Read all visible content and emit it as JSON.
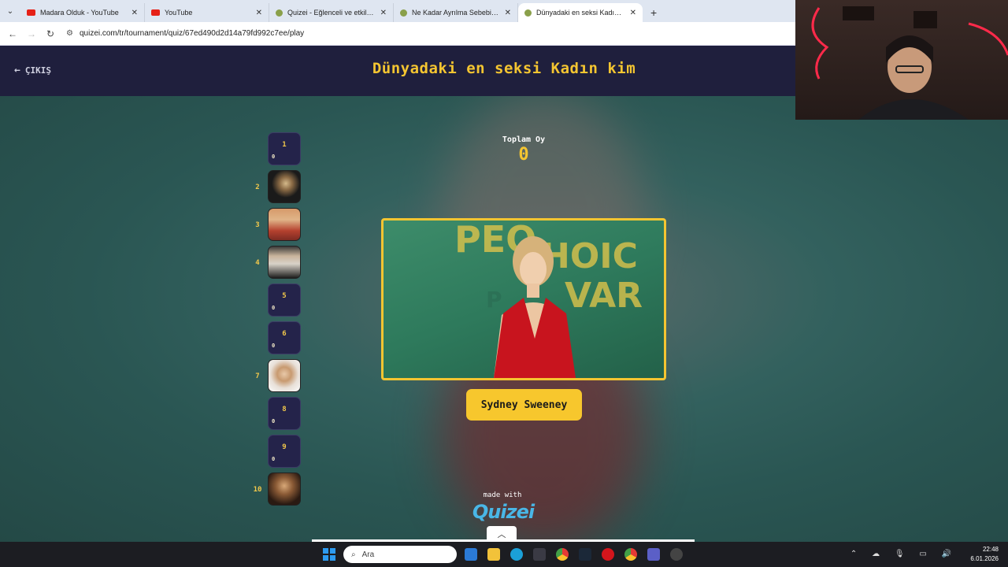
{
  "browser": {
    "tabs": [
      {
        "title": "Madara Olduk - YouTube",
        "favicon": "youtube-icon",
        "active": false
      },
      {
        "title": "YouTube",
        "favicon": "youtube-icon",
        "active": false
      },
      {
        "title": "Quizei - Eğlenceli ve etkileşimli",
        "favicon": "quizei-icon",
        "active": false
      },
      {
        "title": "Ne Kadar Ayrılma Sebebi?? #1 -",
        "favicon": "quizei-icon",
        "active": false
      },
      {
        "title": "Dünyadaki en seksi Kadın kim -",
        "favicon": "quizei-icon",
        "active": true
      }
    ],
    "url": "quizei.com/tr/tournament/quiz/67ed490d2d14a79fd992c7ee/play"
  },
  "header": {
    "exit_label": "ÇIKIŞ",
    "title": "Dünyadaki en seksi Kadın kim"
  },
  "votes": {
    "label": "Toplam Oy",
    "value": "0"
  },
  "contestant": {
    "name": "Sydney Sweeney"
  },
  "slots": [
    {
      "rank": "1",
      "votes": "0",
      "has_image": false
    },
    {
      "rank": "2",
      "has_image": true
    },
    {
      "rank": "3",
      "has_image": true
    },
    {
      "rank": "4",
      "has_image": true
    },
    {
      "rank": "5",
      "votes": "0",
      "has_image": false
    },
    {
      "rank": "6",
      "votes": "0",
      "has_image": false
    },
    {
      "rank": "7",
      "has_image": true
    },
    {
      "rank": "8",
      "votes": "0",
      "has_image": false
    },
    {
      "rank": "9",
      "votes": "0",
      "has_image": false
    },
    {
      "rank": "10",
      "has_image": true
    }
  ],
  "footer": {
    "made_with": "made with",
    "brand": "Quizei"
  },
  "taskbar": {
    "search_placeholder": "Ara",
    "time": "22:48",
    "date": "6.01.2026"
  },
  "colors": {
    "accent": "#f4c531",
    "header_bg": "#1f1f3d",
    "brand": "#49b6e6"
  }
}
